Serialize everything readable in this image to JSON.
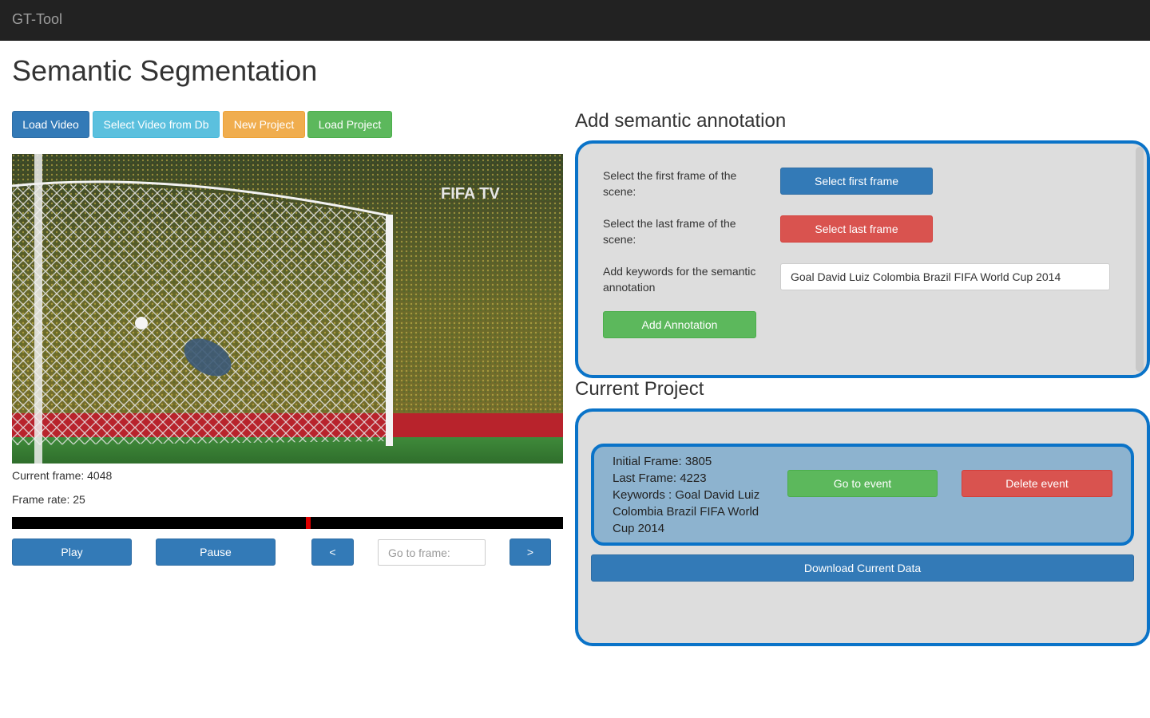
{
  "app": {
    "brand": "GT-Tool"
  },
  "page": {
    "title": "Semantic Segmentation"
  },
  "toolbar": {
    "load_video": "Load Video",
    "select_video_db": "Select Video from Db",
    "new_project": "New Project",
    "load_project": "Load Project"
  },
  "video": {
    "watermark": "FIFA TV",
    "current_frame_label": "Current frame: 4048",
    "frame_rate_label": "Frame rate: 25",
    "progress_fraction": 0.533
  },
  "controls": {
    "play": "Play",
    "pause": "Pause",
    "prev": "<",
    "next": ">",
    "goto_placeholder": "Go to frame:"
  },
  "annotation": {
    "title": "Add semantic annotation",
    "first_frame_label": "Select the first frame of the scene:",
    "first_frame_button": "Select first frame",
    "last_frame_label": "Select the last frame of the scene:",
    "last_frame_button": "Select last frame",
    "keywords_label": "Add keywords for the semantic annotation",
    "keywords_value": "Goal David Luiz Colombia Brazil FIFA World Cup 2014",
    "add_button": "Add Annotation"
  },
  "project": {
    "title": "Current Project",
    "events": [
      {
        "initial_frame": "Initial Frame: 3805",
        "last_frame": "Last Frame: 4223",
        "keywords": "Keywords : Goal David Luiz Colombia Brazil FIFA World Cup 2014",
        "goto_button": "Go to event",
        "delete_button": "Delete event"
      }
    ],
    "download_button": "Download Current Data"
  },
  "colors": {
    "navbar": "#222222",
    "primary": "#337ab7",
    "info": "#5bc0de",
    "warning": "#f0ad4e",
    "success": "#5cb85c",
    "danger": "#d9534f",
    "panel_border": "#0a73c8",
    "panel_bg": "#dddddd",
    "event_bg": "#8db3cf",
    "progress_marker": "#e00000"
  }
}
